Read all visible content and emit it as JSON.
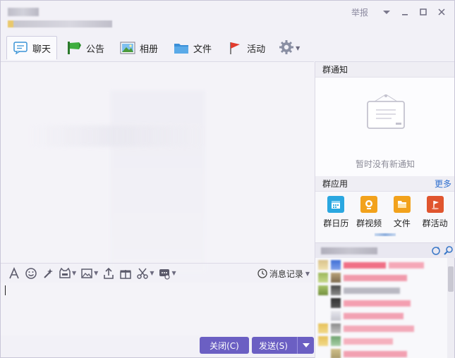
{
  "titlebar": {
    "report_label": "举报"
  },
  "tabs": [
    {
      "label": "聊天",
      "icon": "chat-icon"
    },
    {
      "label": "公告",
      "icon": "megaphone-icon"
    },
    {
      "label": "相册",
      "icon": "photo-icon"
    },
    {
      "label": "文件",
      "icon": "folder-icon"
    },
    {
      "label": "活动",
      "icon": "flag-icon"
    }
  ],
  "input_toolbar": {
    "history_label": "消息记录"
  },
  "buttons": {
    "close_label": "关闭(C)",
    "send_label": "发送(S)"
  },
  "right_panel": {
    "notice_title": "群通知",
    "notice_empty": "暂时没有新通知",
    "apps_title": "群应用",
    "more_label": "更多",
    "apps": [
      {
        "label": "群日历",
        "icon": "calendar-icon",
        "color": "#2aa7e0"
      },
      {
        "label": "群视频",
        "icon": "video-icon",
        "color": "#f2a21c"
      },
      {
        "label": "文件",
        "icon": "folder-icon",
        "color": "#f2a21c"
      },
      {
        "label": "群活动",
        "icon": "event-flag-icon",
        "color": "#e0552e"
      }
    ]
  },
  "colors": {
    "accent": "#6b5fc3",
    "link": "#2f6fcf"
  }
}
